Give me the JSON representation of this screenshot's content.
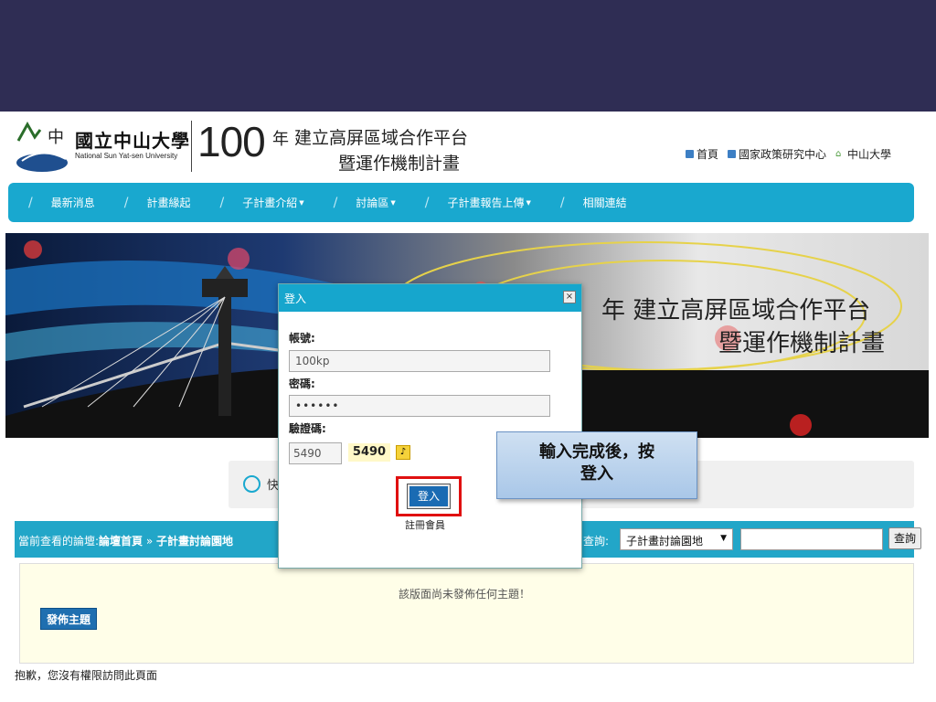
{
  "header": {
    "univ_name": "國立中山大學",
    "univ_en": "National Sun Yat-sen University",
    "year_num": "100",
    "year_word": "年",
    "title_line1": "建立高屏區域合作平台",
    "title_line2": "暨運作機制計畫",
    "top_links": [
      {
        "label": "首頁",
        "icon": "square-bullet-icon"
      },
      {
        "label": "國家政策研究中心",
        "icon": "square-bullet-icon"
      },
      {
        "label": "中山大學",
        "icon": "house-icon"
      }
    ]
  },
  "nav": {
    "items": [
      {
        "label": "最新消息",
        "has_caret": false
      },
      {
        "label": "計畫緣起",
        "has_caret": false
      },
      {
        "label": "子計畫介紹",
        "has_caret": true
      },
      {
        "label": "討論區",
        "has_caret": true
      },
      {
        "label": "子計畫報告上傳",
        "has_caret": true
      },
      {
        "label": "相關連結",
        "has_caret": false
      }
    ]
  },
  "banner": {
    "title_line1": "年 建立高屏區域合作平台",
    "title_line2": "暨運作機制計畫"
  },
  "quick_bar": {
    "text": "快"
  },
  "forum_bar": {
    "crumb_prefix": "當前查看的論壇:",
    "crumb_home": "論壇首頁",
    "crumb_sep": " » ",
    "crumb_current": "子計畫討論園地",
    "search_label": "查詢:",
    "search_select_value": "子計畫討論園地",
    "search_button": "查詢"
  },
  "content": {
    "empty_msg": "該版面尚未發佈任何主題！",
    "post_button": "發佈主題"
  },
  "footer_msg": "抱歉，您沒有權限訪問此頁面",
  "modal": {
    "title": "登入",
    "close": "×",
    "account_label": "帳號:",
    "account_value": "100kp",
    "password_label": "密碼:",
    "password_value": "••••••",
    "captcha_label": "驗證碼:",
    "captcha_value": "5490",
    "captcha_image_text": "5490",
    "login_button": "登入",
    "register_link": "註冊會員"
  },
  "callout": {
    "line1": "輸入完成後，按",
    "line2": "登入"
  },
  "colors": {
    "top_band": "#2f2d54",
    "nav": "#19a8cf",
    "highlight": "#e01010",
    "callout": "#a9c7e8"
  }
}
